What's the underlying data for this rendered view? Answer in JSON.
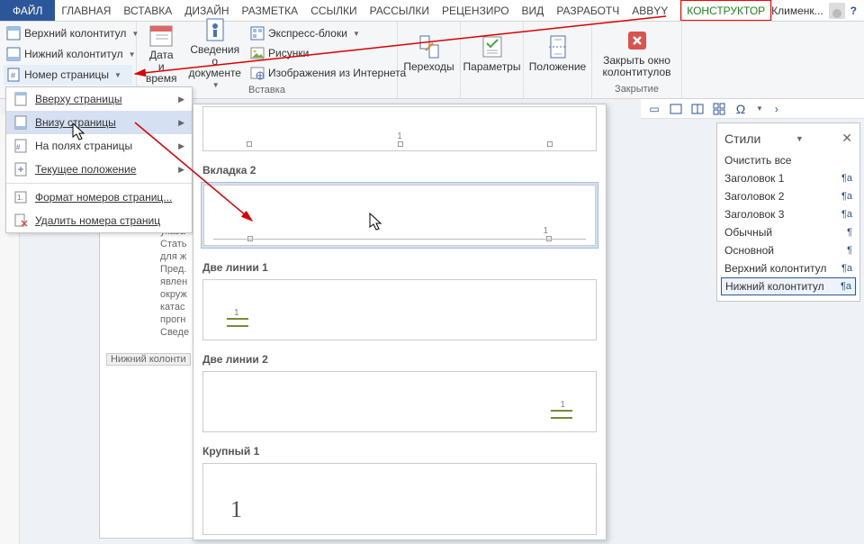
{
  "tabs": {
    "file": "ФАЙЛ",
    "list": [
      "ГЛАВНАЯ",
      "ВСТАВКА",
      "ДИЗАЙН",
      "РАЗМЕТКА С",
      "ССЫЛКИ",
      "РАССЫЛКИ",
      "РЕЦЕНЗИРО",
      "ВИД",
      "РАЗРАБОТЧ",
      "ABBYY FineR"
    ],
    "active": "КОНСТРУКТОР",
    "user": "Клименк..."
  },
  "ribbon": {
    "header_top": "Верхний колонтитул",
    "header_bottom": "Нижний колонтитул",
    "page_number": "Номер страницы",
    "date_time": "Дата и время",
    "doc_info": "Сведения о документе",
    "quick_parts": "Экспресс-блоки",
    "pictures": "Рисунки",
    "online_pics": "Изображения из Интернета",
    "group_insert": "Вставка",
    "nav_header": "Переходы",
    "options": "Параметры",
    "position": "Положение",
    "close": "Закрыть окно колонтитулов",
    "group_close": "Закрытие"
  },
  "menu": {
    "top": "Вверху страницы",
    "bottom": "Внизу страницы",
    "margins": "На полях страницы",
    "current": "Текущее положение",
    "format": "Формат номеров страниц...",
    "remove": "Удалить номера страниц"
  },
  "gallery": {
    "g1": "Вкладка 2",
    "g2": "Две линии 1",
    "g3": "Две линии 2",
    "g4": "Крупный 1",
    "big_num": "1"
  },
  "styles": {
    "title": "Стили",
    "clear": "Очистить все",
    "h1": "Заголовок 1",
    "h2": "Заголовок 2",
    "h3": "Заголовок 3",
    "normal": "Обычный",
    "body": "Основной",
    "header": "Верхний колонтитул",
    "footer": "Нижний колонтитул",
    "para_mark": "¶a",
    "para_only": "¶"
  },
  "doc": {
    "footer_label": "Нижний колонти",
    "lines": [
      "указа",
      "Стать",
      "для ж",
      "Пред.",
      "явлен",
      "окруж",
      "катас",
      "прогн",
      "Сведе"
    ]
  }
}
